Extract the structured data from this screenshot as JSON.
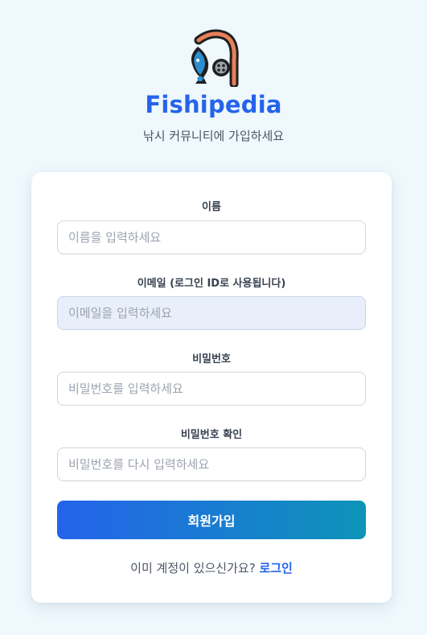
{
  "app": {
    "title": "Fishipedia",
    "subtitle": "낚시 커뮤니티에 가입하세요",
    "logo_icon": "fishing-rod-fish-icon",
    "brand_color": "#2563eb"
  },
  "form": {
    "name": {
      "label": "이름",
      "placeholder": "이름을 입력하세요",
      "value": ""
    },
    "email": {
      "label": "이메일 (로그인 ID로 사용됩니다)",
      "placeholder": "이메일을 입력하세요",
      "value": ""
    },
    "password": {
      "label": "비밀번호",
      "placeholder": "비밀번호를 입력하세요",
      "value": ""
    },
    "password_confirm": {
      "label": "비밀번호 확인",
      "placeholder": "비밀번호를 다시 입력하세요",
      "value": ""
    },
    "submit_label": "회원가입",
    "button_gradient": [
      "#2563eb",
      "#0d94b8"
    ]
  },
  "footer": {
    "prompt": "이미 계정이 있으신가요?",
    "login_link": "로그인"
  }
}
